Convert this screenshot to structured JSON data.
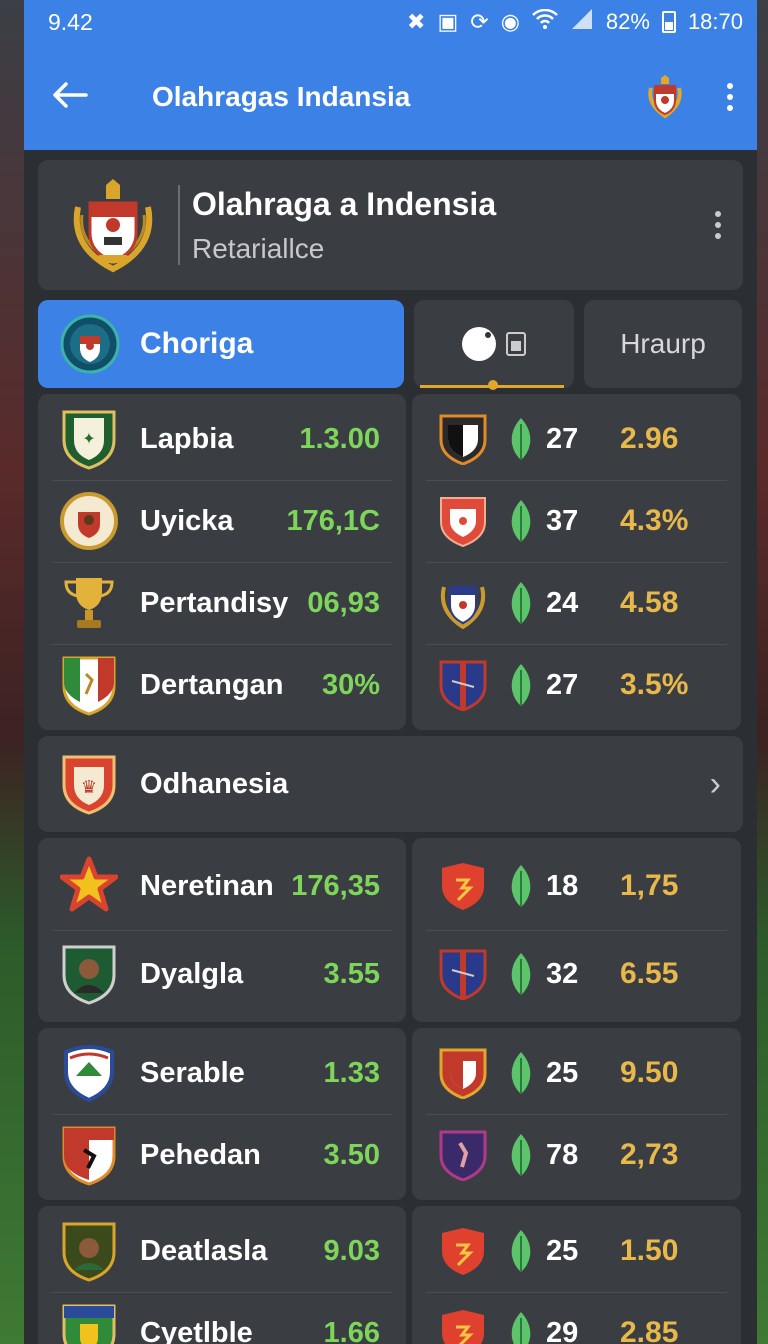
{
  "status_bar": {
    "left": "9.42",
    "battery": "82%",
    "time": "18:70"
  },
  "app_bar": {
    "title": "Olahragas Indansia"
  },
  "header": {
    "title": "Olahraga a Indensia",
    "subtitle": "Retariallce"
  },
  "tabs": {
    "active": "Choriga",
    "last": "Hraurp"
  },
  "group1": {
    "left": [
      {
        "name": "Lapbia",
        "value": "1.3.00"
      },
      {
        "name": "Uyicka",
        "value": "176,1C"
      },
      {
        "name": "Pertandisy",
        "value": "06,93"
      },
      {
        "name": "Dertangan",
        "value": "30%"
      }
    ],
    "right": [
      {
        "num": "27",
        "odd": "2.96"
      },
      {
        "num": "37",
        "odd": "4.3%"
      },
      {
        "num": "24",
        "odd": "4.58"
      },
      {
        "num": "27",
        "odd": "3.5%"
      }
    ]
  },
  "section": {
    "title": "Odhanesia"
  },
  "group2": {
    "left": [
      {
        "name": "Neretinan",
        "value": "176,35"
      },
      {
        "name": "Dyalgla",
        "value": "3.55"
      },
      {
        "name": "Serable",
        "value": "1.33"
      },
      {
        "name": "Pehedan",
        "value": "3.50"
      },
      {
        "name": "Deatlasla",
        "value": "9.03"
      },
      {
        "name": "Cyetlble",
        "value": "1.66"
      }
    ],
    "right": [
      {
        "num": "18",
        "odd": "1,75"
      },
      {
        "num": "32",
        "odd": "6.55"
      },
      {
        "num": "25",
        "odd": "9.50"
      },
      {
        "num": "78",
        "odd": "2,73"
      },
      {
        "num": "25",
        "odd": "1.50"
      },
      {
        "num": "29",
        "odd": "2.85"
      }
    ]
  },
  "colors": {
    "accent": "#3c82e6",
    "positive": "#7dd65a",
    "odds": "#e8b84a",
    "card": "#3a3d42"
  }
}
